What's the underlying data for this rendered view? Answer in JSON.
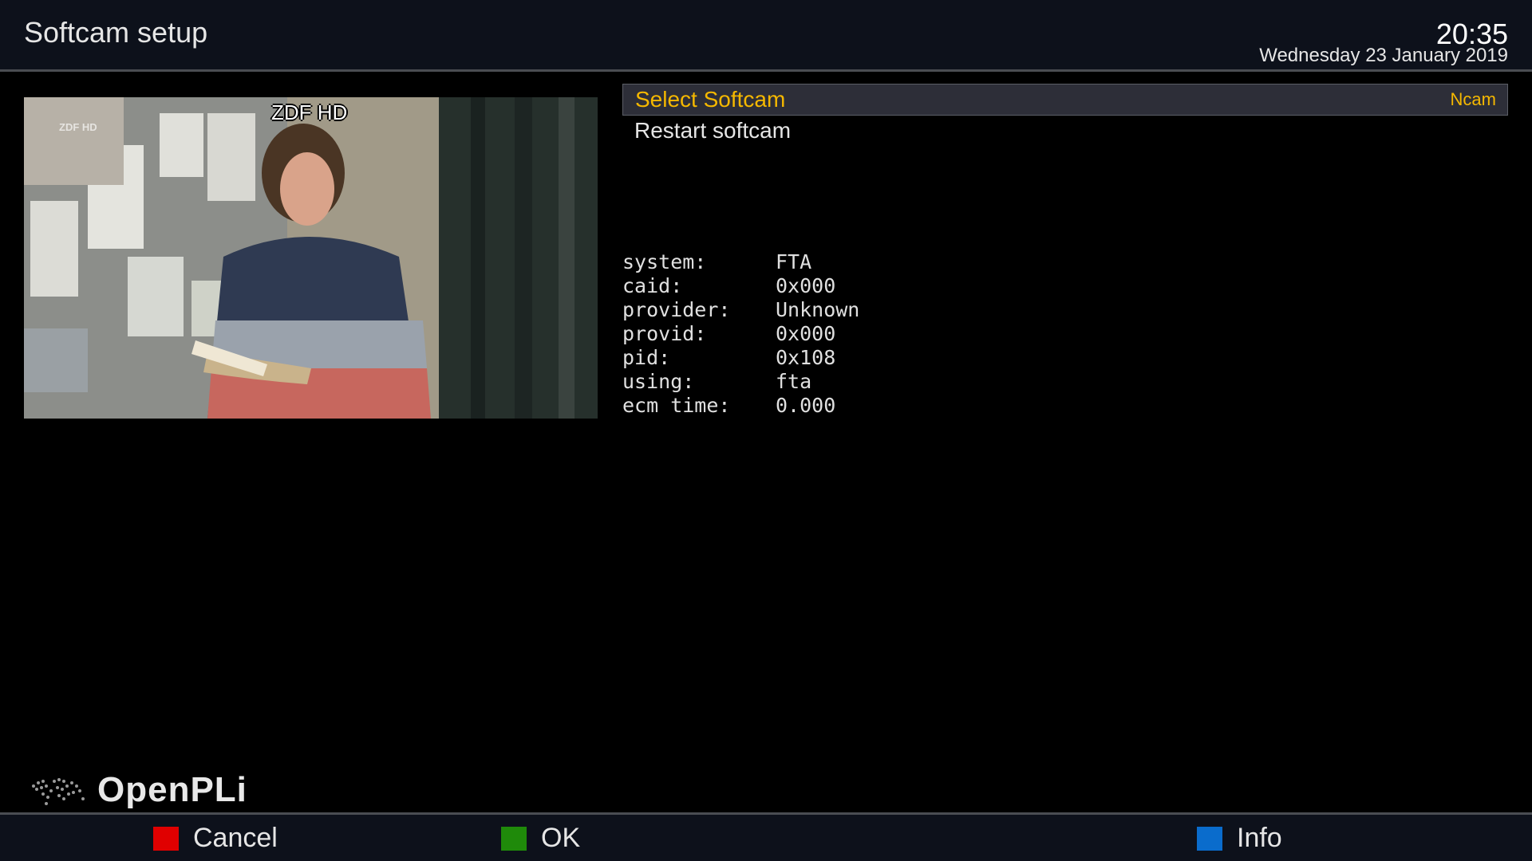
{
  "header": {
    "title": "Softcam setup",
    "time": "20:35",
    "date": "Wednesday 23 January 2019"
  },
  "preview": {
    "channel_label": "ZDF HD",
    "watermark": "ZDF HD"
  },
  "menu": {
    "items": [
      {
        "label": "Select Softcam",
        "value": "Ncam",
        "selected": true
      },
      {
        "label": "Restart softcam",
        "value": "",
        "selected": false
      }
    ]
  },
  "info": {
    "rows": [
      {
        "key": "system:",
        "value": "FTA"
      },
      {
        "key": "caid:",
        "value": "0x000"
      },
      {
        "key": "provider:",
        "value": "Unknown"
      },
      {
        "key": "provid:",
        "value": "0x000"
      },
      {
        "key": "pid:",
        "value": "0x108"
      },
      {
        "key": "using:",
        "value": "fta"
      },
      {
        "key": "ecm time:",
        "value": "0.000"
      }
    ]
  },
  "branding": {
    "logo_text": "OpenPLi"
  },
  "footer": {
    "buttons": [
      {
        "color_name": "red",
        "color": "#e00000",
        "label": "Cancel"
      },
      {
        "color_name": "green",
        "color": "#1f8a0a",
        "label": "OK"
      },
      {
        "color_name": "blue",
        "color": "#0a6ccc",
        "label": "Info"
      }
    ]
  },
  "colors": {
    "accent": "#f5b800",
    "header_bg": "#0d111b"
  }
}
